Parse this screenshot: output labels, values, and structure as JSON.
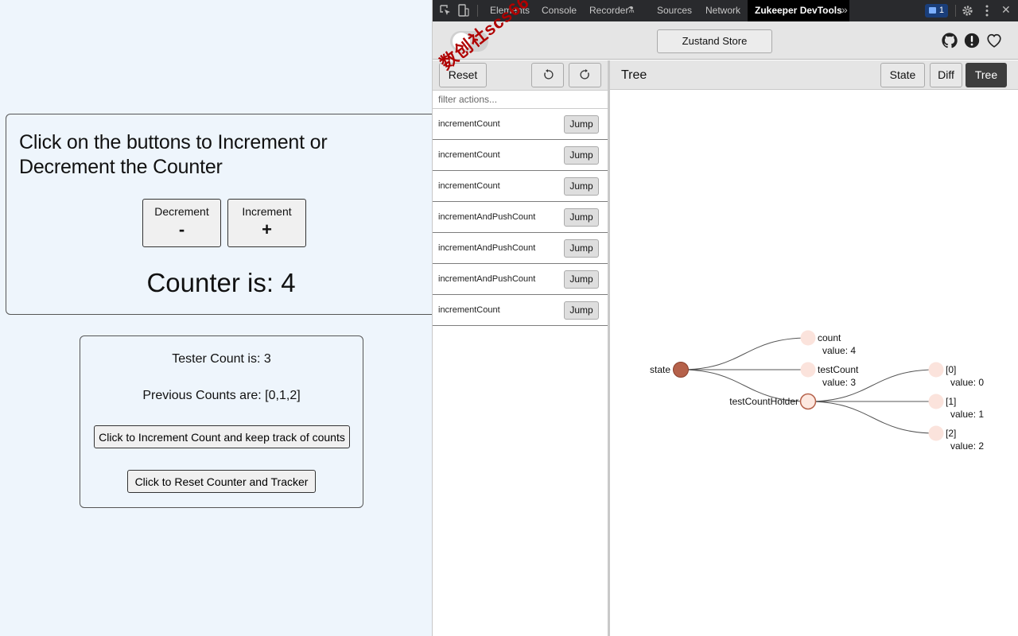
{
  "app": {
    "heading": "Click on the buttons to Increment or Decrement the Counter",
    "decrement": {
      "label": "Decrement",
      "symbol": "-"
    },
    "increment": {
      "label": "Increment",
      "symbol": "+"
    },
    "counter_text": "Counter is: 4",
    "tester_count_text": "Tester Count is: 3",
    "previous_counts_text": "Previous Counts are: [0,1,2]",
    "increment_track_button": "Click to Increment Count and keep track of counts",
    "reset_button": "Click to Reset Counter and Tracker"
  },
  "devtools": {
    "tabs": [
      "Elements",
      "Console",
      "Recorder",
      "Sources",
      "Network",
      "Zukeeper DevTools"
    ],
    "active_tab": "Zukeeper DevTools",
    "messages_badge": "1",
    "store_button": "Zustand Store",
    "toggle_on": false,
    "reset_button": "Reset",
    "filter_placeholder": "filter actions...",
    "jump_label": "Jump",
    "actions": [
      "incrementCount",
      "incrementCount",
      "incrementCount",
      "incrementAndPushCount",
      "incrementAndPushCount",
      "incrementAndPushCount",
      "incrementCount"
    ],
    "tree_title": "Tree",
    "view_buttons": [
      "State",
      "Diff",
      "Tree"
    ],
    "active_view": "Tree",
    "tree": {
      "root": "state",
      "children": [
        {
          "key": "count",
          "value": "value: 4"
        },
        {
          "key": "testCount",
          "value": "value: 3"
        },
        {
          "key": "testCountHolder",
          "children": [
            {
              "key": "[0]",
              "value": "value: 0"
            },
            {
              "key": "[1]",
              "value": "value: 1"
            },
            {
              "key": "[2]",
              "value": "value: 2"
            }
          ]
        }
      ]
    },
    "colors": {
      "root_node": "#b5614a",
      "leaf_node": "#fbe3dc",
      "branch_node": "#fde8e0"
    }
  },
  "watermark": "数创社scs66"
}
